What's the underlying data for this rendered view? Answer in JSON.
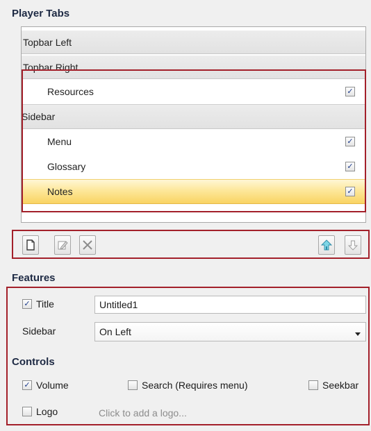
{
  "player_tabs": {
    "title": "Player Tabs",
    "groups": [
      {
        "label": "Topbar Left"
      },
      {
        "label": "Topbar Right"
      },
      {
        "label": "Sidebar"
      }
    ],
    "items": [
      {
        "label": "Resources",
        "checked": true,
        "check_glyph": "✓"
      },
      {
        "label": "Menu",
        "checked": true,
        "check_glyph": "✓"
      },
      {
        "label": "Glossary",
        "checked": true,
        "check_glyph": "✓"
      },
      {
        "label": "Notes",
        "checked": true,
        "selected": true,
        "check_glyph": "✓"
      }
    ]
  },
  "toolbar": {
    "buttons": [
      "new-page-icon",
      "edit-icon",
      "delete-icon",
      "move-up-icon",
      "move-down-icon"
    ]
  },
  "features": {
    "title": "Features",
    "title_label": "Title",
    "title_checked": true,
    "title_check_glyph": "✓",
    "title_value": "Untitled1",
    "sidebar_label": "Sidebar",
    "sidebar_value": "On Left"
  },
  "controls": {
    "title": "Controls",
    "volume_label": "Volume",
    "volume_check_glyph": "✓",
    "search_label": "Search (Requires menu)",
    "seekbar_label": "Seekbar",
    "logo_label": "Logo",
    "logo_hint": "Click to add a logo..."
  },
  "colors": {
    "highlight_frame": "#a3202a",
    "selected_row": "#fde79a",
    "check_mark": "#1b3a8a"
  }
}
